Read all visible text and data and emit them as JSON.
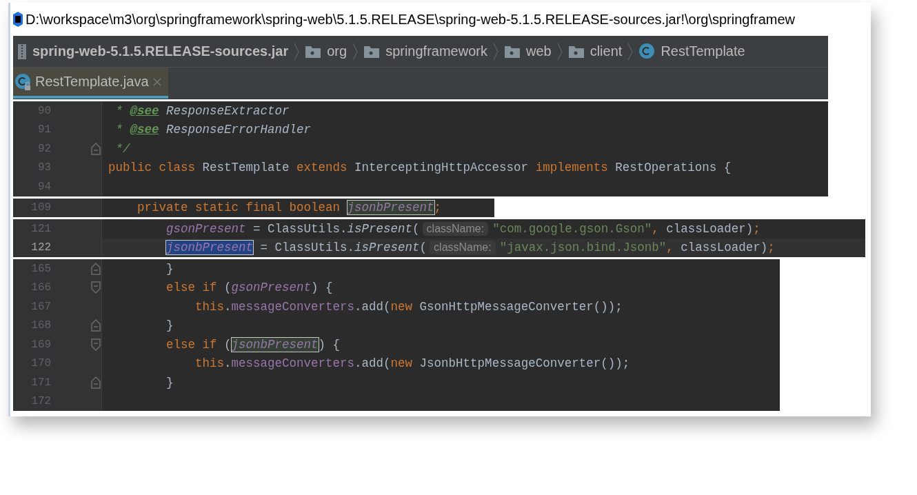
{
  "title_bar": {
    "path": "D:\\workspace\\m3\\org\\springframework\\spring-web\\5.1.5.RELEASE\\spring-web-5.1.5.RELEASE-sources.jar!\\org\\springframew"
  },
  "breadcrumbs": [
    {
      "kind": "jar",
      "label": "spring-web-5.1.5.RELEASE-sources.jar"
    },
    {
      "kind": "folder",
      "label": "org"
    },
    {
      "kind": "folder",
      "label": "springframework"
    },
    {
      "kind": "folder",
      "label": "web"
    },
    {
      "kind": "folder",
      "label": "client"
    },
    {
      "kind": "class",
      "label": "RestTemplate"
    }
  ],
  "tabs": [
    {
      "label": "RestTemplate.java",
      "selected": true
    }
  ],
  "snippets": [
    {
      "lines": [
        {
          "number": "90",
          "current": false,
          "kind": "code",
          "tokens": [
            {
              "kind": "doc",
              "text": " * "
            },
            {
              "kind": "doctag",
              "text": "@see"
            },
            {
              "kind": "docref",
              "text": " ResponseExtractor"
            }
          ]
        },
        {
          "number": "91",
          "current": false,
          "kind": "code",
          "tokens": [
            {
              "kind": "doc",
              "text": " * "
            },
            {
              "kind": "doctag",
              "text": "@see"
            },
            {
              "kind": "docref",
              "text": " ResponseErrorHandler"
            }
          ]
        },
        {
          "number": "92",
          "current": false,
          "kind": "fold-end",
          "tokens": [
            {
              "kind": "doc",
              "text": " */"
            }
          ]
        },
        {
          "number": "93",
          "current": false,
          "kind": "code",
          "tokens": [
            {
              "kind": "keyword",
              "text": "public class "
            },
            {
              "kind": "plain",
              "text": "RestTemplate "
            },
            {
              "kind": "keyword",
              "text": "extends "
            },
            {
              "kind": "plain",
              "text": "InterceptingHttpAccessor "
            },
            {
              "kind": "keyword",
              "text": "implements "
            },
            {
              "kind": "plain",
              "text": "RestOperations {"
            }
          ]
        },
        {
          "number": "94",
          "current": false,
          "kind": "code"
        }
      ]
    },
    {
      "lines": [
        {
          "number": "109",
          "current": false,
          "kind": "code",
          "tokens": [
            {
              "kind": "keyword",
              "text": "    private static final boolean "
            },
            {
              "kind": "read-usage",
              "text": "jsonbPresent"
            },
            {
              "kind": "keyword",
              "text": ";"
            }
          ]
        }
      ]
    },
    {
      "lines": [
        {
          "number": "121",
          "current": false,
          "kind": "code",
          "tokens": [
            {
              "kind": "field",
              "text": "gsonPresent"
            },
            {
              "kind": "plain",
              "text": " = ClassUtils."
            },
            {
              "kind": "static",
              "text": "isPresent"
            },
            {
              "kind": "plain",
              "text": "("
            },
            {
              "kind": "hint",
              "text": "className:"
            },
            {
              "kind": "string",
              "text": "\"com.google.gson.Gson\""
            },
            {
              "kind": "keyword",
              "text": ", "
            },
            {
              "kind": "plain",
              "text": "classLoader)"
            },
            {
              "kind": "keyword",
              "text": ";"
            }
          ]
        },
        {
          "number": "122",
          "current": true,
          "kind": "code",
          "tokens": [
            {
              "kind": "write-usage",
              "text": "jsonbPresent"
            },
            {
              "kind": "plain",
              "text": " = ClassUtils."
            },
            {
              "kind": "static",
              "text": "isPresent"
            },
            {
              "kind": "plain",
              "text": "("
            },
            {
              "kind": "hint",
              "text": "className:"
            },
            {
              "kind": "string",
              "text": "\"javax.json.bind.Jsonb\""
            },
            {
              "kind": "keyword",
              "text": ", "
            },
            {
              "kind": "plain",
              "text": "classLoader)"
            },
            {
              "kind": "keyword",
              "text": ";"
            }
          ]
        }
      ]
    },
    {
      "lines": [
        {
          "number": "165",
          "current": false,
          "kind": "fold-end",
          "tokens": [
            {
              "kind": "plain",
              "text": "        }"
            }
          ]
        },
        {
          "number": "166",
          "current": false,
          "kind": "fold-start",
          "tokens": [
            {
              "kind": "keyword",
              "text": "        else if "
            },
            {
              "kind": "plain",
              "text": "("
            },
            {
              "kind": "field",
              "text": "gsonPresent"
            },
            {
              "kind": "plain",
              "text": ") {"
            }
          ]
        },
        {
          "number": "167",
          "current": false,
          "kind": "code",
          "tokens": [
            {
              "kind": "keyword",
              "text": "            this"
            },
            {
              "kind": "plain",
              "text": "."
            },
            {
              "kind": "member",
              "text": "messageConverters"
            },
            {
              "kind": "plain",
              "text": ".add("
            },
            {
              "kind": "keyword",
              "text": "new "
            },
            {
              "kind": "plain",
              "text": "GsonHttpMessageConverter());"
            }
          ]
        },
        {
          "number": "168",
          "current": false,
          "kind": "fold-end",
          "tokens": [
            {
              "kind": "plain",
              "text": "        }"
            }
          ]
        },
        {
          "number": "169",
          "current": false,
          "kind": "fold-start",
          "tokens": [
            {
              "kind": "keyword",
              "text": "        else if "
            },
            {
              "kind": "plain",
              "text": "("
            },
            {
              "kind": "read-usage",
              "text": "jsonbPresent"
            },
            {
              "kind": "plain",
              "text": ") {"
            }
          ]
        },
        {
          "number": "170",
          "current": false,
          "kind": "code",
          "tokens": [
            {
              "kind": "keyword",
              "text": "            this"
            },
            {
              "kind": "plain",
              "text": "."
            },
            {
              "kind": "member",
              "text": "messageConverters"
            },
            {
              "kind": "plain",
              "text": ".add("
            },
            {
              "kind": "keyword",
              "text": "new "
            },
            {
              "kind": "plain",
              "text": "JsonbHttpMessageConverter());"
            }
          ]
        },
        {
          "number": "171",
          "current": false,
          "kind": "fold-end",
          "tokens": [
            {
              "kind": "plain",
              "text": "        }"
            }
          ]
        },
        {
          "number": "172",
          "current": false,
          "kind": "code"
        }
      ]
    }
  ]
}
